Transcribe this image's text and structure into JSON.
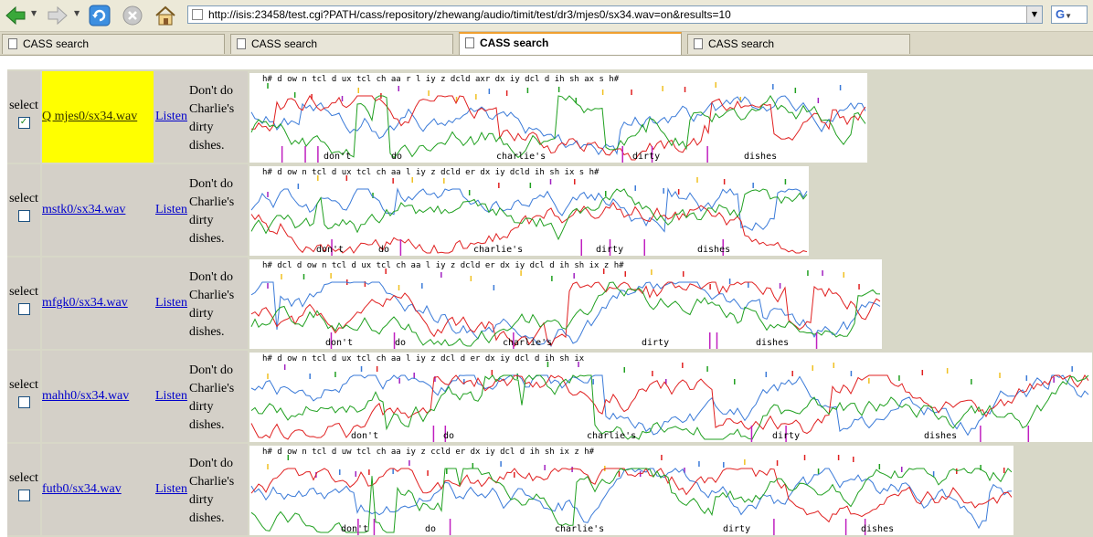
{
  "toolbar": {
    "back_icon": "back-arrow-icon",
    "forward_icon": "forward-arrow-icon",
    "reload_icon": "reload-icon",
    "stop_icon": "stop-icon",
    "home_icon": "home-icon",
    "url": "http://isis:23458/test.cgi?PATH/cass/repository/zhewang/audio/timit/test/dr3/mjes0/sx34.wav=on&results=10",
    "search_engine_label": "G",
    "colors": {
      "back": "#2f9e2f",
      "reload": "#2a7fd4",
      "stop": "#bdbdbd"
    }
  },
  "tabs": [
    {
      "label": "CASS search",
      "active": false
    },
    {
      "label": "CASS search",
      "active": false
    },
    {
      "label": "CASS search",
      "active": true
    },
    {
      "label": "CASS search",
      "active": false
    }
  ],
  "results": {
    "select_label": "select",
    "listen_label": "Listen",
    "sentence_lines": [
      "Don't do",
      "Charlie's",
      "dirty",
      "dishes."
    ],
    "word_labels": [
      "don't",
      "do",
      "charlie's",
      "dirty",
      "dishes"
    ],
    "rows": [
      {
        "file": "Q mjes0/sx34.wav",
        "checked": true,
        "highlight": true,
        "phones": "h#  d  ow   n  tcl  d   ux   tcl ch     aa   r   l   iy   z  dcld   axr  dx iy  dcl   d  ih    sh    ax     s       h#",
        "check_mark": "✓"
      },
      {
        "file": "mstk0/sx34.wav",
        "checked": false,
        "highlight": false,
        "phones": "h#   d   ow   n  tcl d   ux  tcl  ch    aa      l   iy   z  dcld er  dx  iy  dcld  ih     sh    ix     s       h#",
        "check_mark": ""
      },
      {
        "file": "mfgk0/sx34.wav",
        "checked": false,
        "highlight": false,
        "phones": "h# dcl  d   ow    n  tcl  d    ux  tcl  ch     aa     l   iy  z dcld   er   dx  iy  dcl  d    ih    sh    ix       z        h#",
        "check_mark": ""
      },
      {
        "file": "mahh0/sx34.wav",
        "checked": false,
        "highlight": false,
        "phones": "h#  d     ow       n          tcl         d      ux     tcl     ch            aa          l     iy      z      dcl    d     er    dx   iy     dcl    d   ih     sh    ix",
        "check_mark": ""
      },
      {
        "file": "futb0/sx34.wav",
        "checked": false,
        "highlight": false,
        "phones": "h#    d      ow     n   tcl   d     uw    tcl   ch    aa       iy      z  ccld   er  dx iy dcl d   ih   sh    ix      z       h#",
        "check_mark": ""
      }
    ]
  }
}
